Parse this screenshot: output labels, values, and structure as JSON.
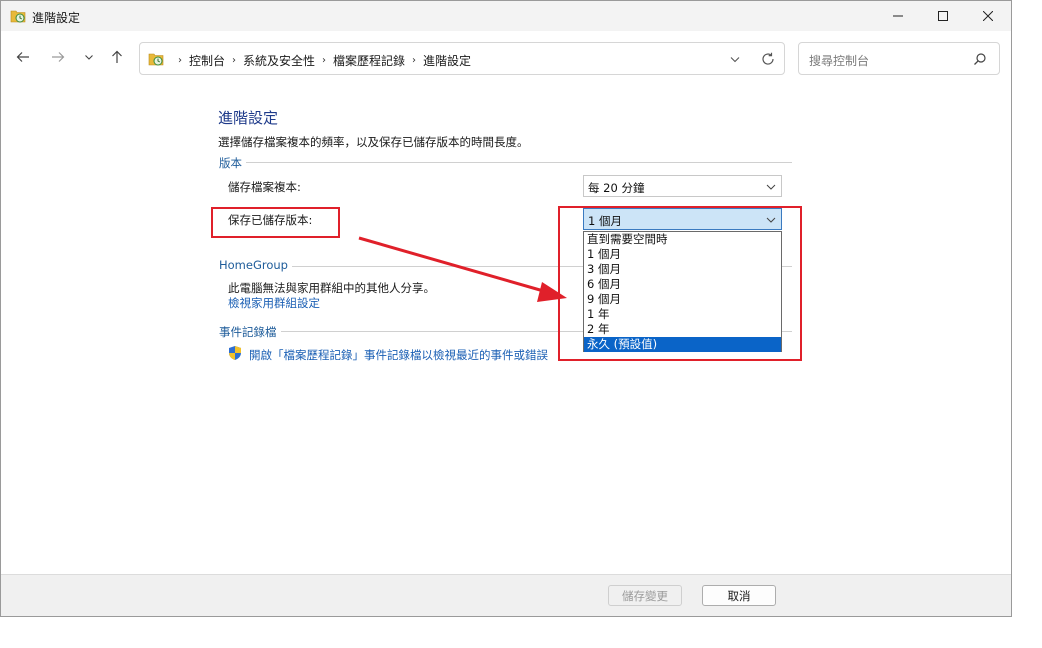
{
  "window": {
    "title": "進階設定"
  },
  "nav": {
    "breadcrumbs": [
      "控制台",
      "系統及安全性",
      "檔案歷程記錄",
      "進階設定"
    ],
    "search_placeholder": "搜尋控制台"
  },
  "main": {
    "title": "進階設定",
    "description": "選擇儲存檔案複本的頻率，以及保存已儲存版本的時間長度。",
    "versions_group": {
      "label": "版本",
      "save_copies_label": "儲存檔案複本:",
      "save_copies_value": "每 20 分鐘",
      "keep_versions_label": "保存已儲存版本:",
      "keep_versions_value": "1 個月",
      "keep_versions_options": [
        "直到需要空間時",
        "1 個月",
        "3 個月",
        "6 個月",
        "9 個月",
        "1 年",
        "2 年",
        "永久 (預設值)"
      ],
      "highlighted_option_index": 7
    },
    "homegroup_group": {
      "label": "HomeGroup",
      "info": "此電腦無法與家用群組中的其他人分享。",
      "link": "檢視家用群組設定"
    },
    "eventlog_group": {
      "label": "事件記錄檔",
      "link": "開啟「檔案歷程記錄」事件記錄檔以檢視最近的事件或錯誤"
    }
  },
  "footer": {
    "save_label": "儲存變更",
    "cancel_label": "取消"
  },
  "colors": {
    "annotation_red": "#e0202a",
    "accent_blue": "#0a64c8",
    "link_blue": "#1a5fb4"
  }
}
